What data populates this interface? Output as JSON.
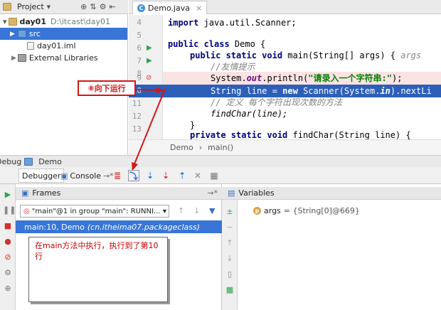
{
  "project": {
    "tab_label": "Project",
    "module": "day01",
    "module_path": "D:\\itcast\\day01",
    "folder_src": "src",
    "file_iml": "day01.iml",
    "external_libraries": "External Libraries"
  },
  "editor": {
    "tab": "Demo.java",
    "line_numbers": [
      "4",
      "5",
      "6",
      "7",
      "8",
      "9",
      "10",
      "11",
      "12",
      "13",
      "14"
    ],
    "code": {
      "l4_kw": "import",
      "l4_rest": " java.util.Scanner;",
      "l6_kw": "public class",
      "l6_rest": " Demo {",
      "l7_kw": "public static void",
      "l7_rest": " main(String[] args) {",
      "l7_hint": "args",
      "l8": "//友情提示",
      "l9_a": "System.",
      "l9_field": "out",
      "l9_b": ".println(",
      "l9_str": "\"请录入一个字符串:\"",
      "l9_c": ");",
      "l10_a": "String line = ",
      "l10_kw": "new",
      "l10_b": " Scanner(System.",
      "l10_field": "in",
      "l10_c": ").nextLi",
      "l11": "// 定义 每个字符出现次数的方法",
      "l12": "findChar(line);",
      "l13": "}",
      "l14_kw": "private static void",
      "l14_rest": " findChar(String line) {"
    },
    "breadcrumb": [
      "Demo",
      "main()"
    ]
  },
  "debug": {
    "title_prefix": "Debug",
    "title": "Demo",
    "tabs": {
      "debugger": "Debugger",
      "console": "Console"
    },
    "frames_title": "Frames",
    "thread": "\"main\"@1 in group \"main\": RUNNI...",
    "frame": "main:10, Demo",
    "frame_package": "(cn.itheima07.packageclass)",
    "variables_title": "Variables",
    "variable": {
      "name": "args",
      "value": "= {String[0]@669}"
    }
  },
  "annotations": {
    "step_callout": "⑧向下运行",
    "note": "在main方法中执行，执行到了第10行"
  },
  "colors": {
    "selection": "#3875d7",
    "execution_line": "#2d5fb8",
    "breakpoint_line": "#fae3e3",
    "annotation_red": "#d01818"
  }
}
